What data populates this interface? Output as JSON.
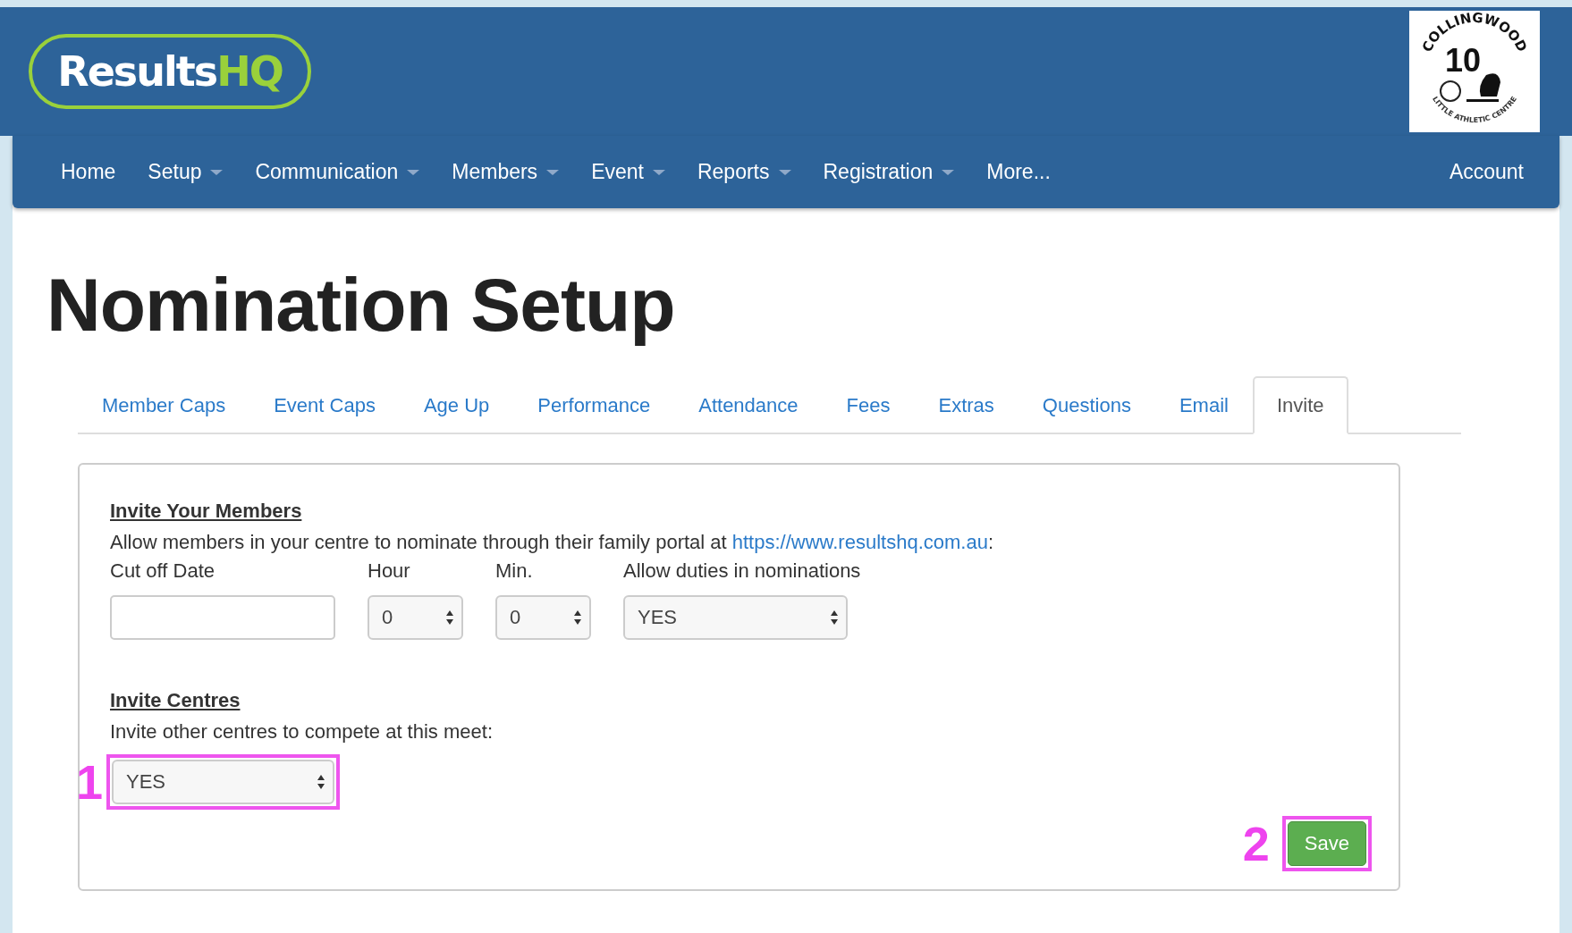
{
  "header": {
    "brand": {
      "name": "Results",
      "suffix": "HQ"
    },
    "club_logo": {
      "top": "COLLINGWOOD",
      "number": "10",
      "bottom": "LITTLE ATHLETIC CENTRE"
    }
  },
  "nav": {
    "items": [
      {
        "label": "Home",
        "dropdown": false
      },
      {
        "label": "Setup",
        "dropdown": true
      },
      {
        "label": "Communication",
        "dropdown": true
      },
      {
        "label": "Members",
        "dropdown": true
      },
      {
        "label": "Event",
        "dropdown": true
      },
      {
        "label": "Reports",
        "dropdown": true
      },
      {
        "label": "Registration",
        "dropdown": true
      },
      {
        "label": "More...",
        "dropdown": false
      }
    ],
    "account": "Account"
  },
  "page_title": "Nomination Setup",
  "tabs": [
    {
      "label": "Member Caps",
      "selected": false
    },
    {
      "label": "Event Caps",
      "selected": false
    },
    {
      "label": "Age Up",
      "selected": false
    },
    {
      "label": "Performance",
      "selected": false
    },
    {
      "label": "Attendance",
      "selected": false
    },
    {
      "label": "Fees",
      "selected": false
    },
    {
      "label": "Extras",
      "selected": false
    },
    {
      "label": "Questions",
      "selected": false
    },
    {
      "label": "Email",
      "selected": false
    },
    {
      "label": "Invite",
      "selected": true
    }
  ],
  "invite_members": {
    "heading": "Invite Your Members",
    "text": "Allow members in your centre to nominate through their family portal at",
    "link": "https://www.resultshq.com.au",
    "text_end": ":",
    "fields": [
      {
        "kind": "date",
        "label": "Cut off Date"
      },
      {
        "kind": "select",
        "label": "Hour",
        "value": "0"
      },
      {
        "kind": "select",
        "label": "Min.",
        "value": "0"
      },
      {
        "kind": "select",
        "label": "Allow duties in nominations",
        "value": "YES"
      }
    ]
  },
  "invite_centres": {
    "heading": "Invite Centres",
    "text": "Invite other centres to compete at this meet:",
    "value": "YES",
    "annotation": "1"
  },
  "save": {
    "label": "Save",
    "annotation": "2"
  }
}
